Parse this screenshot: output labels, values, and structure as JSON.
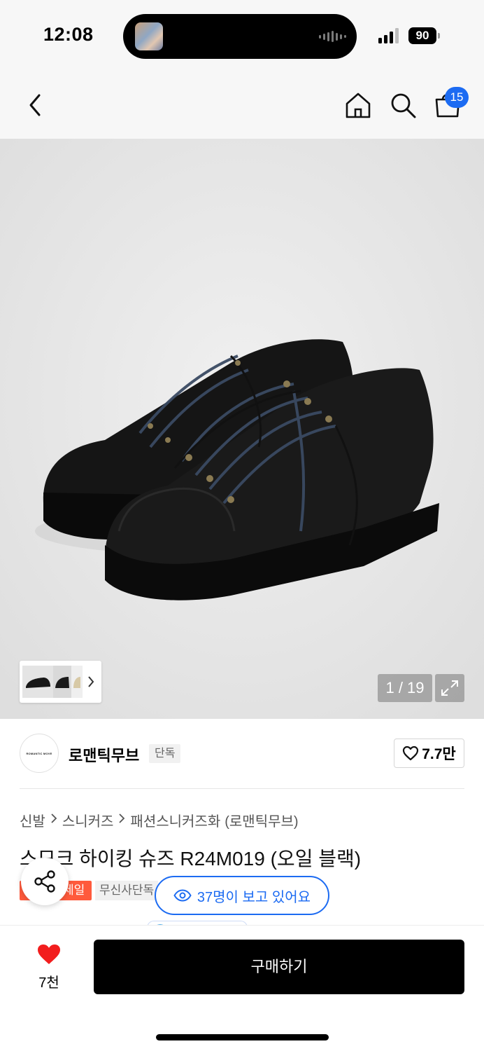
{
  "status_bar": {
    "time": "12:08",
    "battery": "90"
  },
  "nav": {
    "cart_count": "15",
    "icons": [
      "back-icon",
      "home-icon",
      "search-icon",
      "shopping-bag-icon"
    ]
  },
  "gallery": {
    "counter": "1 / 19"
  },
  "brand": {
    "logo_text": "ROMANTIC MOVE",
    "name": "로맨틱무브",
    "tag": "단독",
    "likes": "7.7만"
  },
  "breadcrumb": [
    "신발",
    "스니커즈",
    "패션스니커즈화",
    "(로맨틱무브)"
  ],
  "product": {
    "title": "스모크 하이킹 슈즈 R24M019 (오일 블랙)",
    "tags": [
      "세일",
      "무신사단독"
    ],
    "viewers": "37명이 보고 있어요"
  },
  "bottom": {
    "fav_count": "7천",
    "buy_label": "구매하기"
  },
  "colors": {
    "accent_blue": "#1c6bf2",
    "sale_orange": "#ff5a3c",
    "heart_red": "#f21d1d"
  }
}
